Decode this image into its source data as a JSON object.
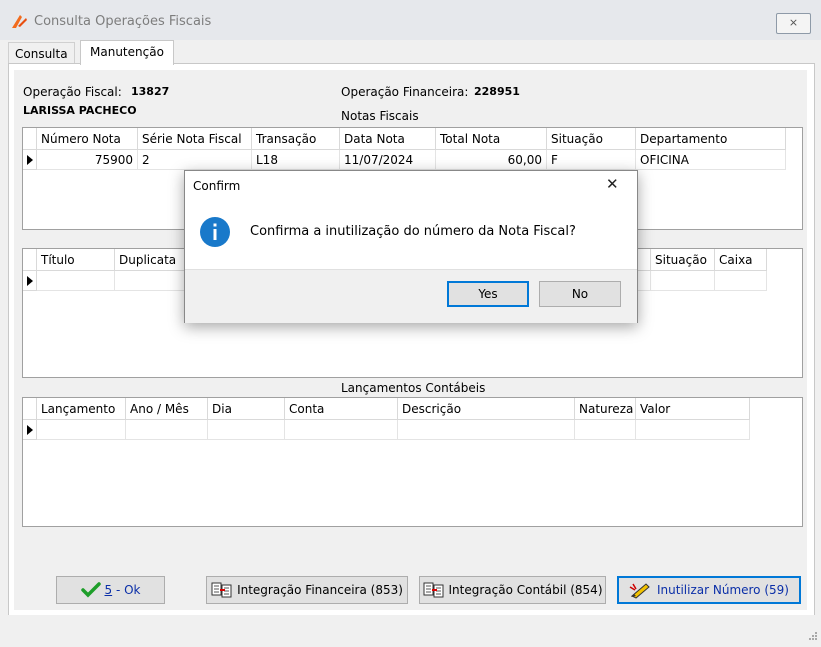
{
  "window": {
    "title": "Consulta Operações Fiscais",
    "close_glyph": "⨯"
  },
  "tabs": [
    {
      "label": "Consulta"
    },
    {
      "label": "Manutenção"
    }
  ],
  "header": {
    "op_fiscal_label": "Operação Fiscal:",
    "op_fiscal_value": "13827",
    "op_financeira_label": "Operação Financeira:",
    "op_financeira_value": "228951",
    "client_name": "LARISSA PACHECO"
  },
  "notas": {
    "caption": "Notas Fiscais",
    "columns": [
      "Número Nota",
      "Série Nota Fiscal",
      "Transação",
      "Data Nota",
      "Total Nota",
      "Situação",
      "Departamento"
    ],
    "rows": [
      [
        "75900",
        "2",
        "L18",
        "11/07/2024",
        "60,00",
        "F",
        "OFICINA"
      ]
    ]
  },
  "titulos": {
    "columns_left": [
      "Título",
      "Duplicata"
    ],
    "columns_right": [
      "Situação",
      "Caixa"
    ]
  },
  "lancamentos": {
    "caption": "Lançamentos Contábeis",
    "columns": [
      "Lançamento",
      "Ano / Mês",
      "Dia",
      "Conta",
      "Descrição",
      "Natureza",
      "Valor"
    ]
  },
  "buttons": {
    "ok_hotkey": "5",
    "ok_label": " - Ok",
    "integ_fin": "Integração Financeira (853)",
    "integ_cont": "Integração Contábil (854)",
    "inutilizar": "Inutilizar Número (59)"
  },
  "dialog": {
    "title": "Confirm",
    "message": "Confirma a inutilização do número da Nota Fiscal?",
    "yes": "Yes",
    "no": "No",
    "close_glyph": "✕",
    "icon": "info-icon"
  },
  "colors": {
    "accent": "#0078d7",
    "info": "#1979ca"
  }
}
